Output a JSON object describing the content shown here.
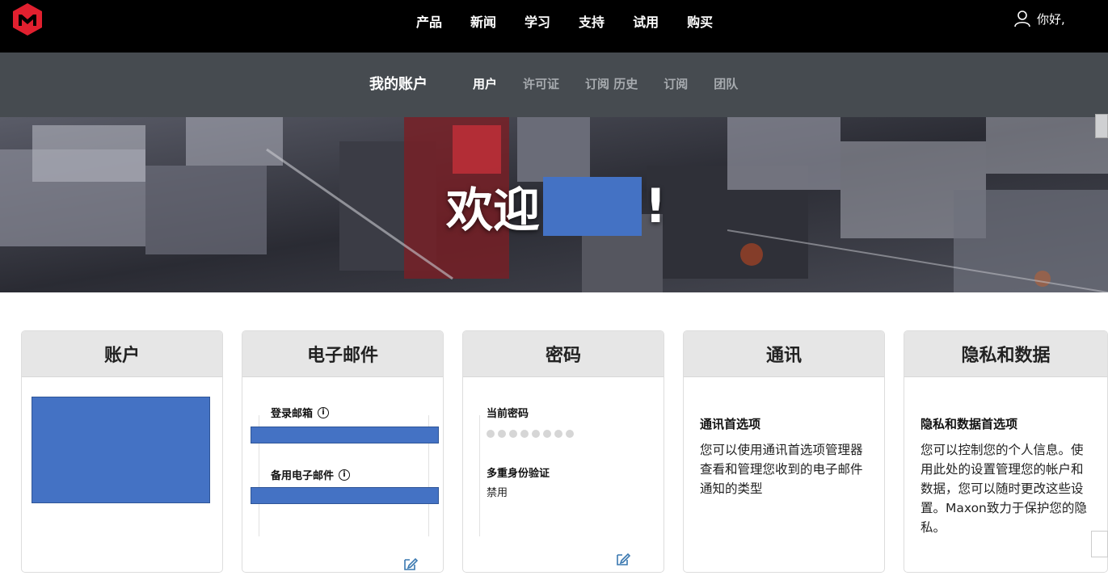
{
  "topnav": {
    "items": [
      "产品",
      "新闻",
      "学习",
      "支持",
      "试用",
      "购买"
    ],
    "greeting": "你好,"
  },
  "subnav": {
    "title": "我的账户",
    "tabs": [
      {
        "label": "用户",
        "active": true
      },
      {
        "label": "许可证",
        "active": false
      },
      {
        "label": "订阅 历史",
        "active": false
      },
      {
        "label": "订阅",
        "active": false
      },
      {
        "label": "团队",
        "active": false
      }
    ]
  },
  "hero": {
    "welcome": "欢迎",
    "exclaim": "!"
  },
  "cards": {
    "account": {
      "title": "账户"
    },
    "email": {
      "title": "电子邮件",
      "login_label": "登录邮箱",
      "backup_label": "备用电子邮件"
    },
    "password": {
      "title": "密码",
      "current_label": "当前密码",
      "mfa_label": "多重身份验证",
      "mfa_value": "禁用",
      "masked_count": 8
    },
    "newsletter": {
      "title": "通讯",
      "heading": "通讯首选项",
      "body": "您可以使用通讯首选项管理器查看和管理您收到的电子邮件通知的类型"
    },
    "privacy": {
      "title": "隐私和数据",
      "heading": "隐私和数据首选项",
      "body": "您可以控制您的个人信息。使用此处的设置管理您的帐户和数据，您可以随时更改这些设置。Maxon致力于保护您的隐私。"
    }
  },
  "colors": {
    "topbar": "#000000",
    "subbar": "#464b50",
    "brand_red": "#e1202f",
    "redaction": "#4472c4"
  }
}
